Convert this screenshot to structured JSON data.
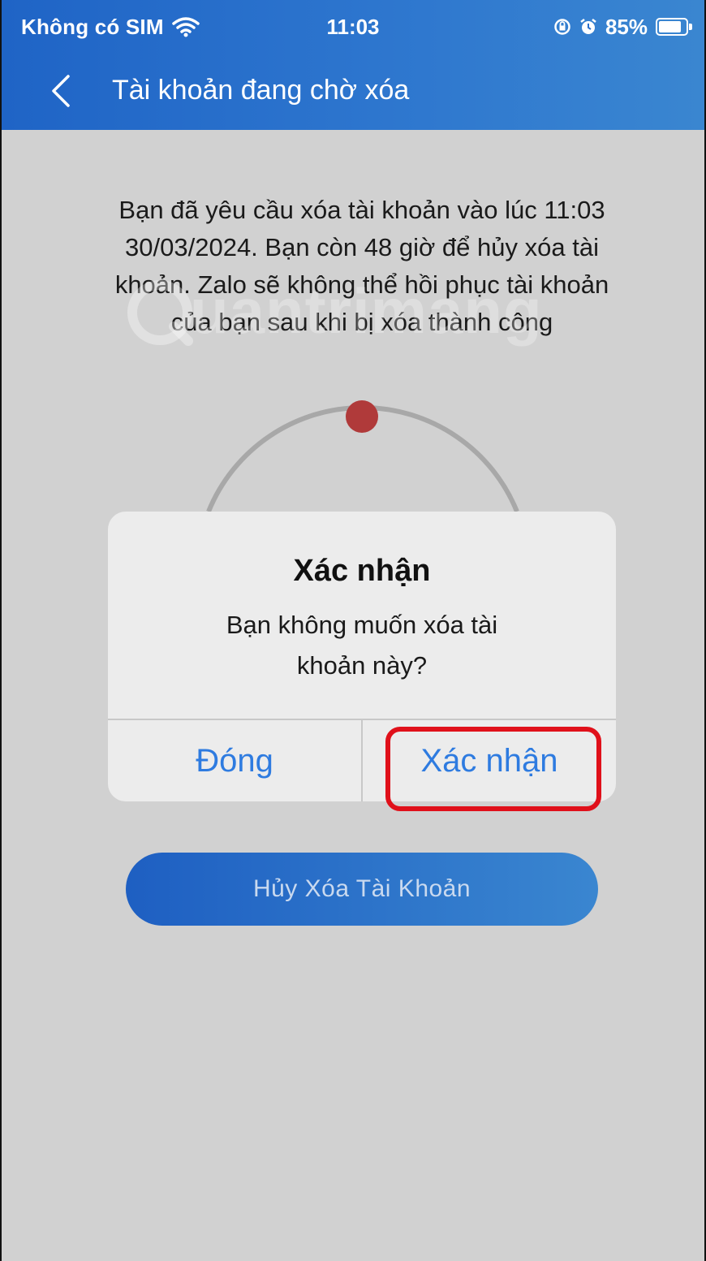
{
  "status_bar": {
    "carrier": "Không có SIM",
    "time": "11:03",
    "battery_percent": "85%",
    "battery_level": 0.85,
    "icons": [
      "wifi-icon",
      "orientation-lock-icon",
      "alarm-icon",
      "battery-icon"
    ]
  },
  "nav": {
    "title": "Tài khoản đang chờ xóa",
    "back_icon": "chevron-left-icon"
  },
  "content": {
    "info_lines": [
      "Bạn đã yêu cầu xóa tài khoản vào lúc 11:03",
      "30/03/2024. Bạn còn 48 giờ để hủy xóa tài",
      "khoản. Zalo sẽ không thể hồi phục tài khoản",
      "của bạn sau khi bị xóa thành công"
    ],
    "watermark": "uantrimang",
    "cancel_delete_button": "Hủy Xóa Tài Khoản"
  },
  "dialog": {
    "title": "Xác nhận",
    "message_lines": [
      "Bạn không muốn xóa tài",
      "khoản này?"
    ],
    "close_label": "Đóng",
    "confirm_label": "Xác nhận"
  },
  "colors": {
    "header": "#1f64c6",
    "content_bg": "#d1d1d1",
    "dialog_button": "#2e7be0",
    "timer_dot": "#b03a3a",
    "highlight": "#e0101a"
  }
}
